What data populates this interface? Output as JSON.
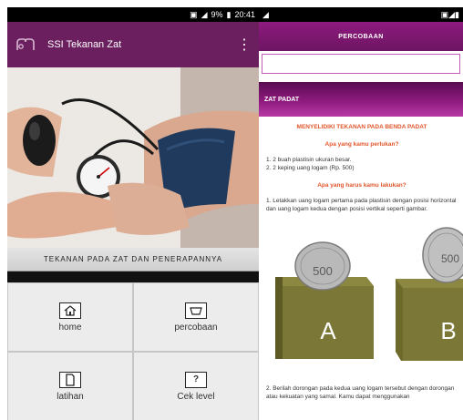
{
  "left": {
    "status": {
      "battery": "9%",
      "time": "20:41"
    },
    "app_title": "SSI Tekanan Zat",
    "caption": "TEKANAN PADA ZAT DAN PENERAPANNYA",
    "menu": [
      {
        "label": "home",
        "icon": "home-icon"
      },
      {
        "label": "percobaan",
        "icon": "flask-icon"
      },
      {
        "label": "latihan",
        "icon": "document-icon"
      },
      {
        "label": "Cek level",
        "icon": "question-icon"
      }
    ]
  },
  "right": {
    "header": "PERCOBAAN",
    "section": "ZAT PADAT",
    "title": "MENYELIDIKI TEKANAN PADA BENDA PADAT",
    "q1": "Apa yang kamu perlukan?",
    "items": [
      "1.   2 buah plastisin ukuran besar.",
      "2.   2 keping uang logam (Rp. 500)"
    ],
    "q2": "Apa yang harus kamu lakukan?",
    "step1": "1.   Letakkan uang logam pertama pada plastisin dengan posisi horizontal dan uang logam kedua dengan posisi vertikal seperti gambar.",
    "coin_value": "500",
    "label_a": "A",
    "label_b": "B",
    "step2": "2.   Berilah dorongan pada kedua uang logam tersebut dengan dorongan atau kekuatan yang samal. Kamu dapat menggunakan"
  },
  "colors": {
    "primary": "#6b1f5f",
    "accent": "#8e1a7e",
    "heading": "#e2562c"
  }
}
